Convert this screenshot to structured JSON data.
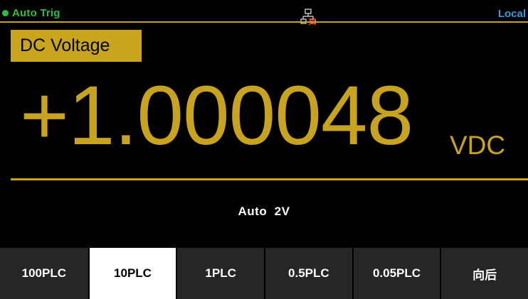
{
  "status": {
    "trigger_label": "Auto Trig",
    "remote_label": "Local",
    "colors": {
      "trigger": "#2fbf3c",
      "remote": "#3a9ad9",
      "accent": "#c8a31f"
    }
  },
  "function_label": "DC Voltage",
  "measurement": {
    "value": "+1.000048",
    "unit": "VDC"
  },
  "range_label": "Auto  2V",
  "softkeys": [
    {
      "label": "100PLC",
      "active": false
    },
    {
      "label": "10PLC",
      "active": true
    },
    {
      "label": "1PLC",
      "active": false
    },
    {
      "label": "0.5PLC",
      "active": false
    },
    {
      "label": "0.05PLC",
      "active": false
    },
    {
      "label": "向后",
      "active": false
    }
  ],
  "icons": {
    "network": "network-disconnected-icon"
  }
}
